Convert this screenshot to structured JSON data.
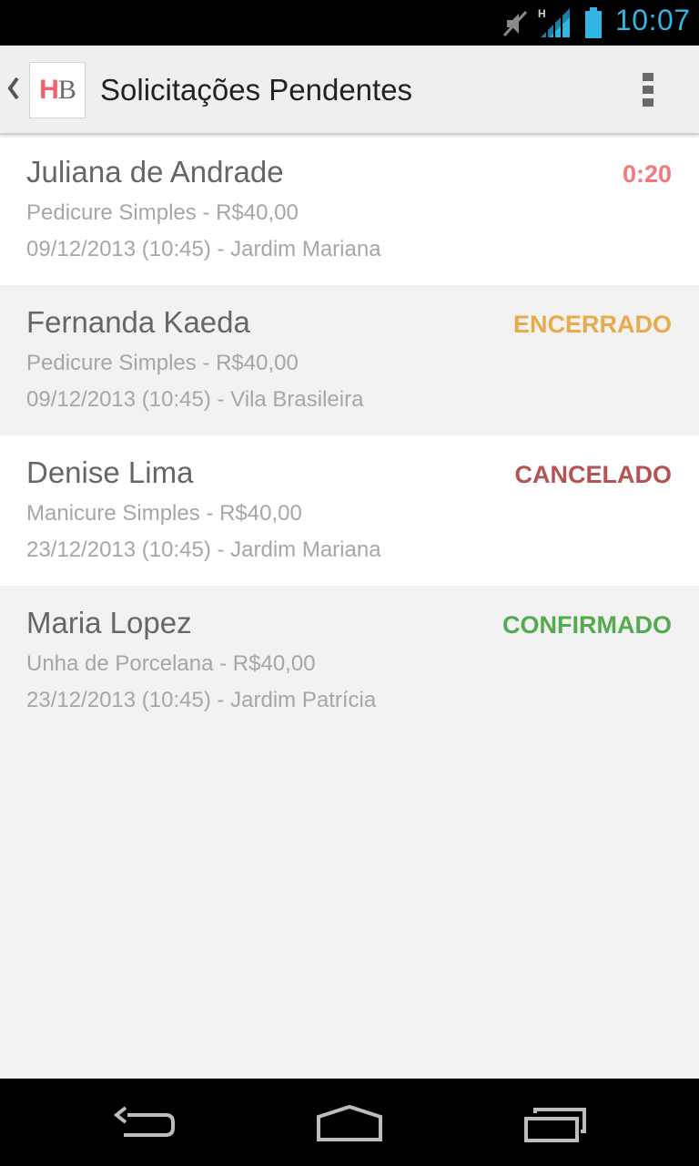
{
  "status_bar": {
    "time": "10:07",
    "icons": [
      "mute-icon",
      "signal-hspa-icon",
      "battery-icon"
    ],
    "accent_color": "#33b5e5"
  },
  "app_bar": {
    "logo": {
      "h": "H",
      "b": "B"
    },
    "title": "Solicitações Pendentes",
    "icons": [
      "up-caret-icon",
      "overflow-menu-icon"
    ]
  },
  "requests": [
    {
      "name": "Juliana de Andrade",
      "service": "Pedicure Simples - R$40,00",
      "when": "09/12/2013 (10:45) - Jardim Mariana",
      "status": "0:20",
      "status_color": "#f4777b"
    },
    {
      "name": "Fernanda Kaeda",
      "service": "Pedicure Simples - R$40,00",
      "when": "09/12/2013 (10:45) - Vila Brasileira",
      "status": "ENCERRADO",
      "status_color": "#e9aa4d"
    },
    {
      "name": "Denise Lima",
      "service": "Manicure Simples - R$40,00",
      "when": "23/12/2013 (10:45) - Jardim Mariana",
      "status": "CANCELADO",
      "status_color": "#b45254"
    },
    {
      "name": "Maria Lopez",
      "service": "Unha de Porcelana - R$40,00",
      "when": "23/12/2013 (10:45) - Jardim Patrícia",
      "status": "CONFIRMADO",
      "status_color": "#55aa4f"
    }
  ],
  "nav_bar": {
    "icons": [
      "back-icon",
      "home-icon",
      "recent-apps-icon"
    ]
  }
}
